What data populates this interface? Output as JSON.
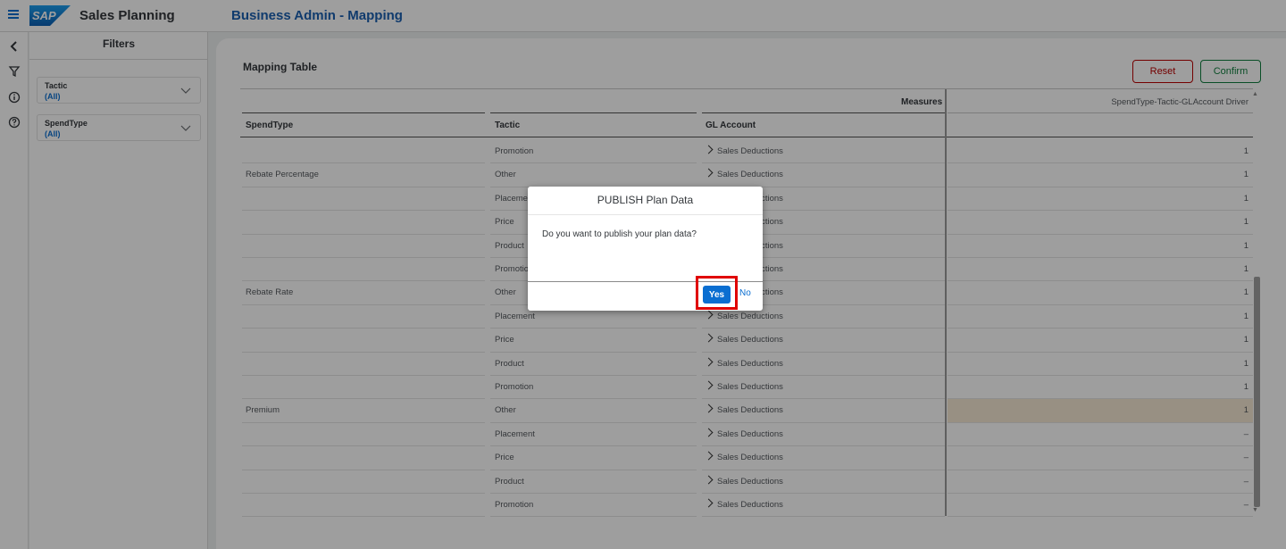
{
  "header": {
    "app_title": "Sales Planning",
    "page_title": "Business Admin - Mapping",
    "logo_text": "SAP"
  },
  "filters": {
    "title": "Filters",
    "items": [
      {
        "label": "Tactic",
        "value": "(All)"
      },
      {
        "label": "SpendType",
        "value": "(All)"
      }
    ]
  },
  "main": {
    "title": "Mapping Table",
    "reset_label": "Reset",
    "confirm_label": "Confirm"
  },
  "table": {
    "measures_label": "Measures",
    "measure_header": "SpendType-Tactic-GLAccount Driver",
    "headers": [
      "SpendType",
      "Tactic",
      "GL Account"
    ],
    "rows": [
      {
        "spend": "",
        "tactic": "Promotion",
        "gl": "Sales Deductions",
        "value": "1"
      },
      {
        "spend": "Rebate Percentage",
        "tactic": "Other",
        "gl": "Sales Deductions",
        "value": "1"
      },
      {
        "spend": "",
        "tactic": "Placement",
        "gl": "Sales Deductions",
        "value": "1"
      },
      {
        "spend": "",
        "tactic": "Price",
        "gl": "Sales Deductions",
        "value": "1"
      },
      {
        "spend": "",
        "tactic": "Product",
        "gl": "Sales Deductions",
        "value": "1"
      },
      {
        "spend": "",
        "tactic": "Promotion",
        "gl": "Sales Deductions",
        "value": "1"
      },
      {
        "spend": "Rebate Rate",
        "tactic": "Other",
        "gl": "Sales Deductions",
        "value": "1"
      },
      {
        "spend": "",
        "tactic": "Placement",
        "gl": "Sales Deductions",
        "value": "1"
      },
      {
        "spend": "",
        "tactic": "Price",
        "gl": "Sales Deductions",
        "value": "1"
      },
      {
        "spend": "",
        "tactic": "Product",
        "gl": "Sales Deductions",
        "value": "1"
      },
      {
        "spend": "",
        "tactic": "Promotion",
        "gl": "Sales Deductions",
        "value": "1"
      },
      {
        "spend": "Premium",
        "tactic": "Other",
        "gl": "Sales Deductions",
        "value": "1",
        "highlight": true
      },
      {
        "spend": "",
        "tactic": "Placement",
        "gl": "Sales Deductions",
        "value": "–"
      },
      {
        "spend": "",
        "tactic": "Price",
        "gl": "Sales Deductions",
        "value": "–"
      },
      {
        "spend": "",
        "tactic": "Product",
        "gl": "Sales Deductions",
        "value": "–"
      },
      {
        "spend": "",
        "tactic": "Promotion",
        "gl": "Sales Deductions",
        "value": "–"
      }
    ]
  },
  "dialog": {
    "title": "PUBLISH Plan Data",
    "message": "Do you want to publish your plan data?",
    "yes_label": "Yes",
    "no_label": "No"
  },
  "colors": {
    "accent": "#0a6ed1",
    "title_blue": "#1b5fb0",
    "reset_red": "#bb0000",
    "confirm_green": "#107e3e",
    "highlight_box": "#e00000",
    "row_highlight": "#f5e9d3"
  },
  "icons": {
    "menu": "hamburger-menu-icon",
    "collapse": "chevron-left-icon",
    "filter": "filter-icon",
    "info": "info-icon",
    "help": "help-icon",
    "dropdown": "chevron-down-icon",
    "expand_row": "chevron-right-icon"
  }
}
